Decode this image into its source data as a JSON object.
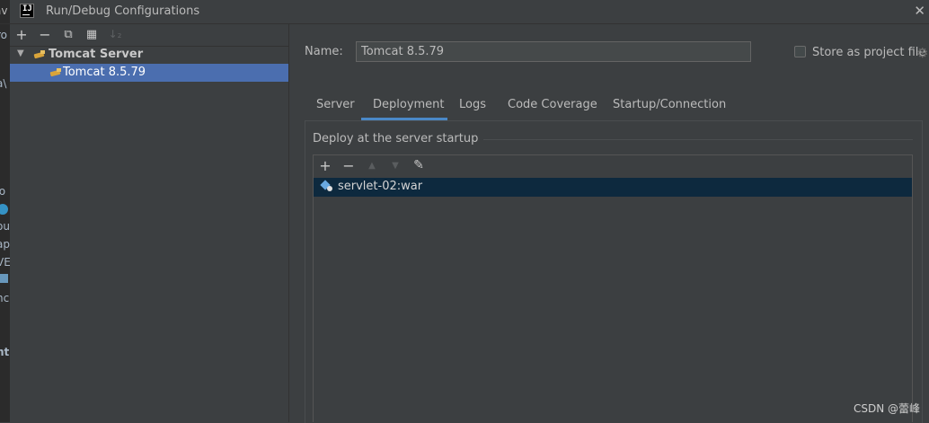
{
  "window": {
    "title": "Run/Debug Configurations",
    "close_symbol": "✕"
  },
  "background_ide": {
    "fragments": [
      "av",
      "ro",
      "a\\",
      "ю",
      "ou",
      "ap",
      "VE",
      "nc",
      "nt"
    ]
  },
  "left_toolbar": {
    "add": "+",
    "remove": "−",
    "copy": "⧉",
    "folder": "▦",
    "sort": "↓₂"
  },
  "tree": {
    "group_label": "Tomcat Server",
    "item_label": "Tomcat 8.5.79"
  },
  "form": {
    "name_label": "Name:",
    "name_value": "Tomcat 8.5.79",
    "store_label": "Store as project file"
  },
  "tabs": [
    {
      "label": "Server"
    },
    {
      "label": "Deployment"
    },
    {
      "label": "Logs"
    },
    {
      "label": "Code Coverage"
    },
    {
      "label": "Startup/Connection"
    }
  ],
  "deployment": {
    "section_title": "Deploy at the server startup",
    "toolbar": {
      "add": "+",
      "remove": "−",
      "up": "▲",
      "down": "▼",
      "edit": "✎"
    },
    "items": [
      {
        "label": "servlet-02:war"
      }
    ]
  },
  "watermark": "CSDN @蕾峰",
  "colors": {
    "background": "#3c3f41",
    "selection": "#4b6eaf",
    "list_selection": "#0d293e",
    "tab_underline": "#4a88c7"
  }
}
